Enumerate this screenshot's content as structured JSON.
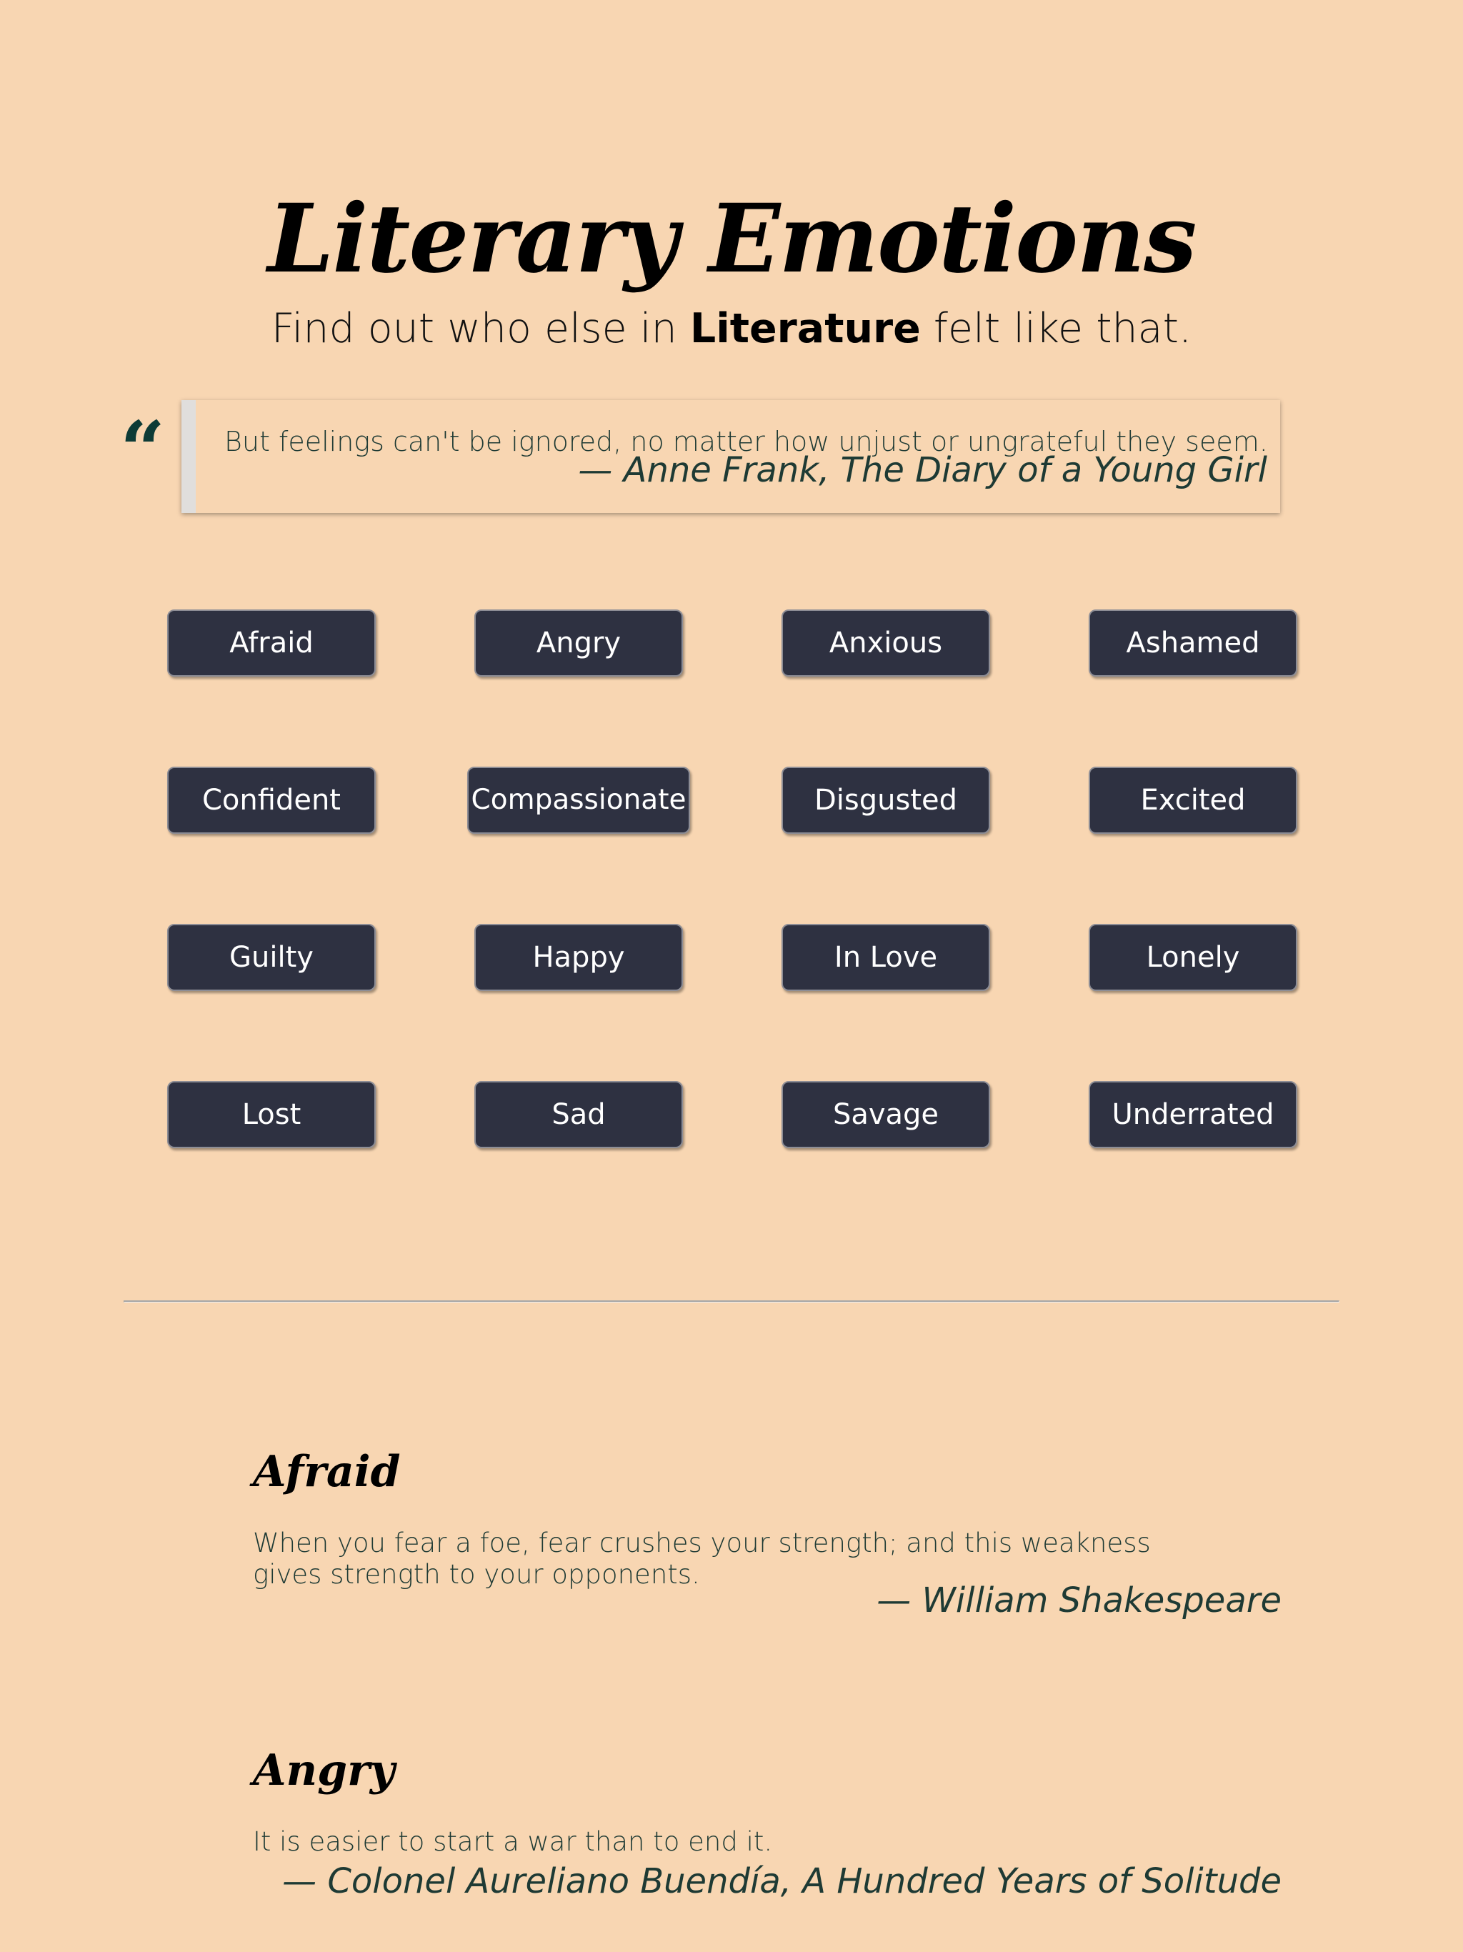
{
  "header": {
    "title": "Literary Emotions",
    "subtitle_pre": "Find out who else in ",
    "subtitle_bold": "Literature",
    "subtitle_post": " felt like that."
  },
  "featured_quote": {
    "mark": "“",
    "text": "But feelings can't be ignored, no matter how unjust or ungrateful they seem.",
    "author": "— Anne Frank, The Diary of a Young Girl"
  },
  "emotions": [
    "Afraid",
    "Angry",
    "Anxious",
    "Ashamed",
    "Confident",
    "Compassionate",
    "Disgusted",
    "Excited",
    "Guilty",
    "Happy",
    "In Love",
    "Lonely",
    "Lost",
    "Sad",
    "Savage",
    "Underrated"
  ],
  "entries": [
    {
      "heading": "Afraid",
      "text": "When you fear a foe, fear crushes your strength; and this weakness gives strength to your opponents.",
      "author": "— William Shakespeare"
    },
    {
      "heading": "Angry",
      "text": "It is easier to start a war than to end it.",
      "author": "— Colonel Aureliano Buendía, A Hundred Years of Solitude"
    }
  ],
  "colors": {
    "background": "#f8d6b2",
    "button": "#2e3141",
    "quote_text": "#1e3a34"
  }
}
